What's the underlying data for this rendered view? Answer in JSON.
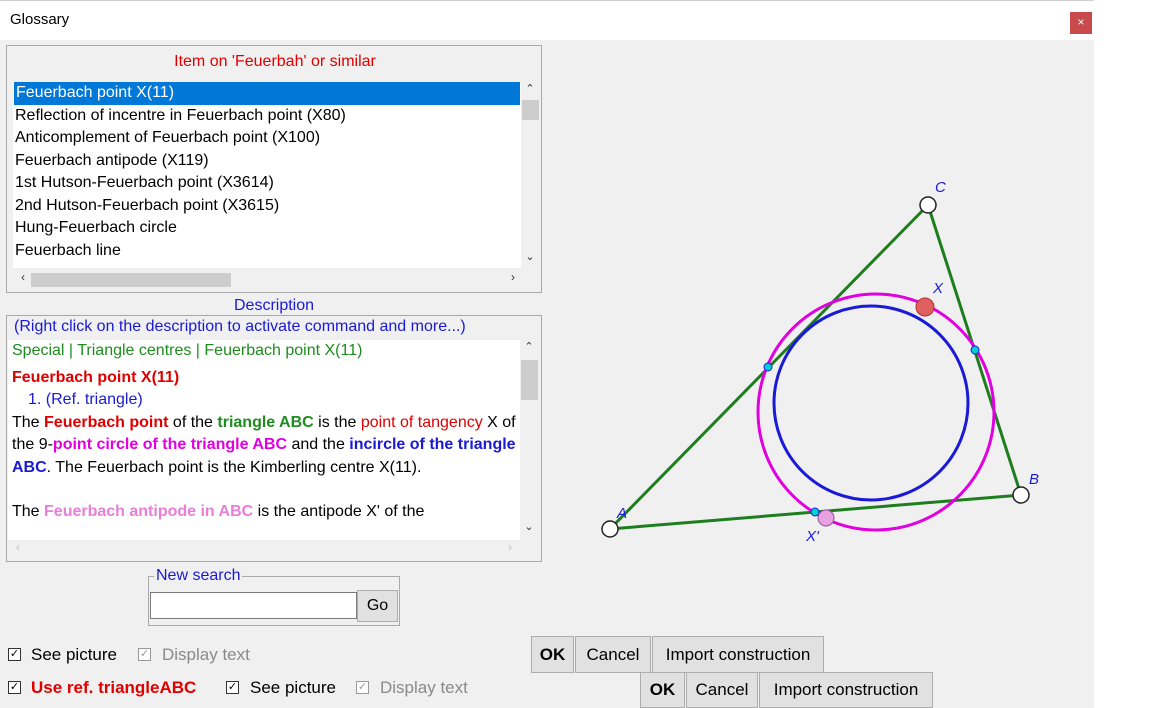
{
  "window": {
    "title": "Glossary",
    "close_glyph": "×"
  },
  "items_header": "Item on 'Feuerbah' or similar",
  "items": [
    "Feuerbach point X(11)",
    "Reflection of incentre in Feuerbach point (X80)",
    "Anticomplement of Feuerbach point (X100)",
    "Feuerbach antipode (X119)",
    "1st Hutson-Feuerbach point (X3614)",
    "2nd Hutson-Feuerbach point (X3615)",
    "Hung-Feuerbach circle",
    "Feuerbach line"
  ],
  "description": {
    "title": "Description",
    "hint": "(Right click on the description to activate command and more...)",
    "breadcrumb": "Special | Triangle centres | Feuerbach point X(11)",
    "heading": "Feuerbach point X(11)",
    "ref_item": "1.  (Ref. triangle)",
    "p1": {
      "t1": "The ",
      "t2": "Feuerbach point",
      "t3": " of the ",
      "t4": "triangle ABC",
      "t5": " is the ",
      "t6": "point of tangency",
      "t7": " X of the 9-",
      "t8": "point circle of the triangle ABC",
      "t9": " and the ",
      "t10": "incircle of the triangle ABC",
      "t11": ". The Feuerbach point is the Kimberling centre X(11)."
    },
    "p2": {
      "t1": "The ",
      "t2": "Feuerbach antipode in ABC",
      "t3": " is the antipode X' of the"
    }
  },
  "search": {
    "legend": "New search",
    "value": "",
    "go_label": "Go"
  },
  "row1": {
    "see_picture": "See picture",
    "display_text": "Display text",
    "ok": "OK",
    "cancel": "Cancel",
    "import": "Import construction"
  },
  "row2": {
    "use_ref": "Use ref. triangleABC",
    "see_picture": "See picture",
    "display_text": "Display text",
    "ok": "OK",
    "cancel": "Cancel",
    "import": "Import construction"
  },
  "figure": {
    "labels": {
      "A": "A",
      "B": "B",
      "C": "C",
      "X": "X",
      "Xp": "X'"
    },
    "colors": {
      "triangle": "#1e7d1e",
      "nine_point_circle": "#e000e0",
      "incircle": "#1a1ad6",
      "point_x": "#e06060",
      "point_xp": "#e8a0e0",
      "tangent_points": "#00d0d0"
    }
  },
  "checkbox_mark": "✓"
}
